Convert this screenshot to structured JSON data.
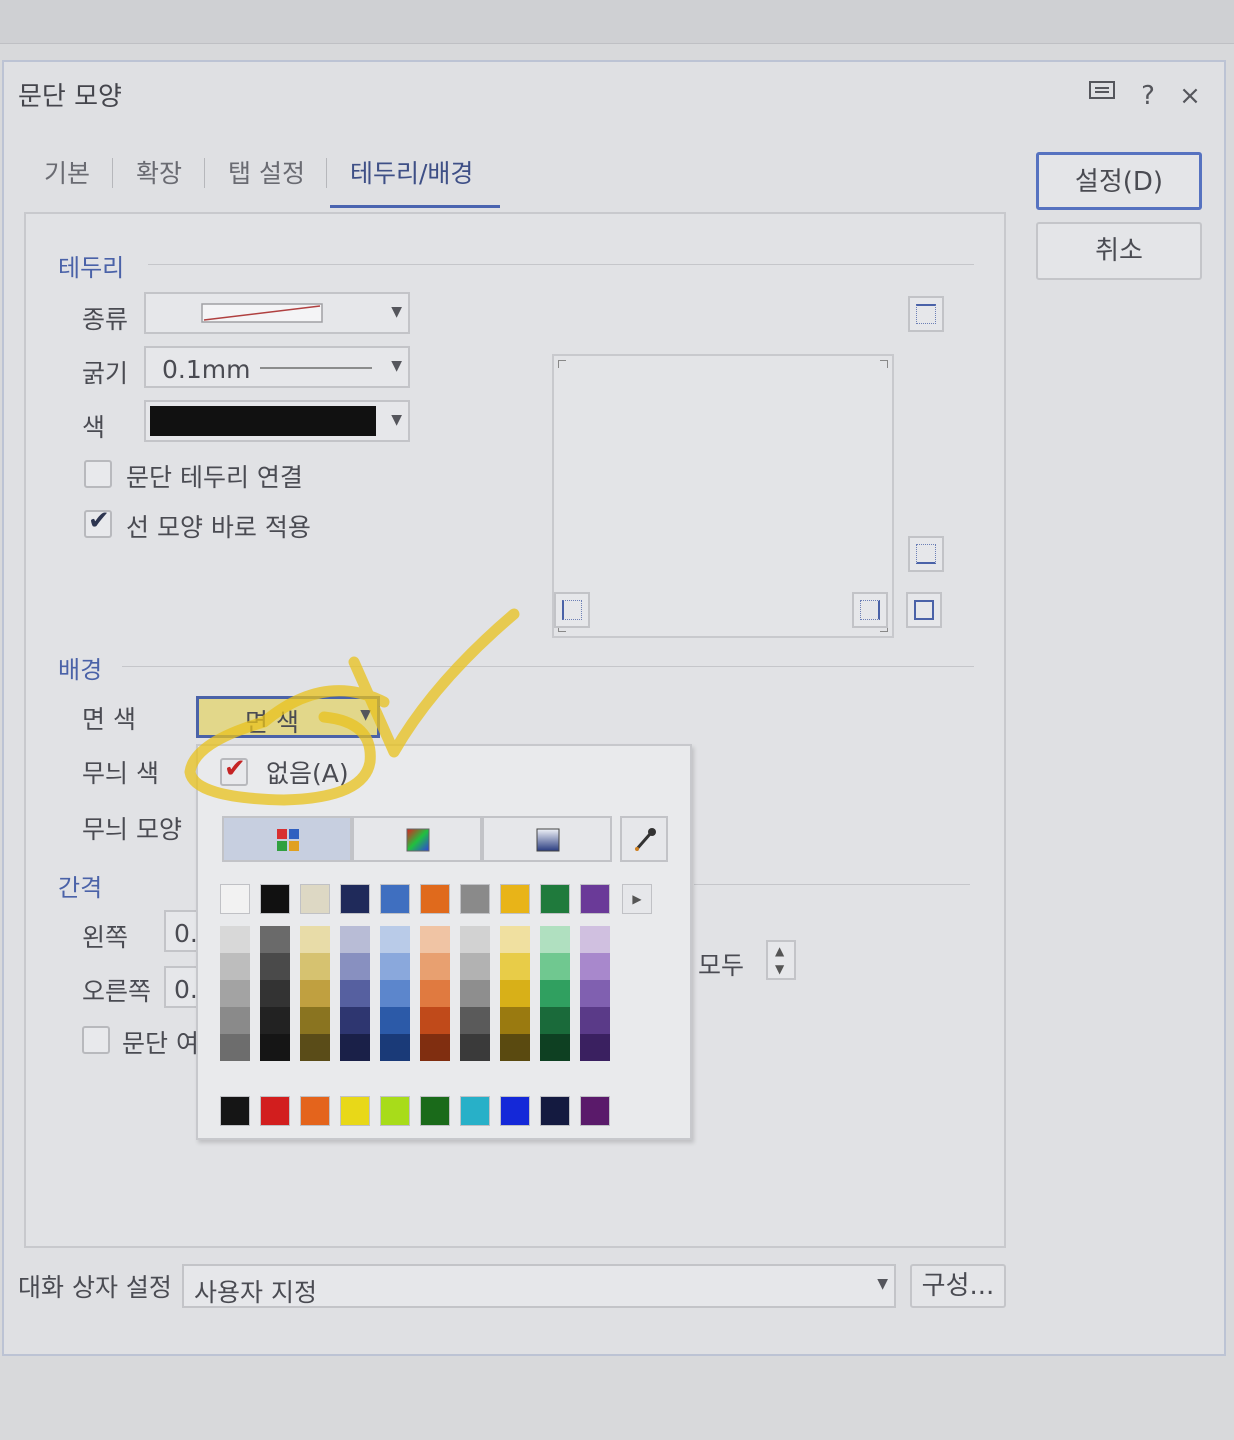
{
  "dialog": {
    "title": "문단 모양",
    "icons": [
      "comment-icon",
      "help-icon",
      "close-icon"
    ],
    "help_glyph": "?",
    "close_glyph": "×"
  },
  "tabs": [
    {
      "label": "기본"
    },
    {
      "label": "확장"
    },
    {
      "label": "탭 설정"
    },
    {
      "label": "테두리/배경",
      "active": true
    }
  ],
  "buttons": {
    "ok_label": "설정(D)",
    "cancel_label": "취소",
    "config_label": "구성..."
  },
  "border_section": {
    "title": "테두리",
    "type_label": "종류",
    "width_label": "굵기",
    "width_value": "0.1mm",
    "color_label": "색",
    "color_value": "#111111",
    "connect_label": "문단 테두리 연결",
    "connect_checked": false,
    "apply_label": "선 모양 바로 적용",
    "apply_checked": true
  },
  "background_section": {
    "title": "배경",
    "face_color_label": "면 색",
    "face_color_button": "면 색",
    "pattern_color_label": "무늬 색",
    "pattern_shape_label": "무늬 모양"
  },
  "spacing_section": {
    "title": "간격",
    "left_label": "왼쪽",
    "left_value": "0.",
    "right_label": "오른쪽",
    "right_value": "0.",
    "all_label": "모두",
    "paragraph_check_label": "문단 여"
  },
  "color_popup": {
    "none_label": "없음(A)",
    "none_checked": true,
    "top_row": [
      "#f2f2f2",
      "#111111",
      "#ddd8c4",
      "#1f2a5a",
      "#3f6fc0",
      "#e06a1c",
      "#8a8a8a",
      "#e8b418",
      "#1f7a3c",
      "#6a3a98"
    ],
    "shade_columns": [
      [
        "#d8d8d8",
        "#bdbdbd",
        "#a3a3a3",
        "#8a8a8a",
        "#6d6d6d"
      ],
      [
        "#6a6a6a",
        "#4a4a4a",
        "#333333",
        "#222222",
        "#151515"
      ],
      [
        "#e8dca8",
        "#d6c270",
        "#c0a040",
        "#8a7420",
        "#5a4c18"
      ],
      [
        "#b8bcd6",
        "#8890c0",
        "#5660a0",
        "#2e3670",
        "#1a2048"
      ],
      [
        "#b9cbe8",
        "#8aa8dc",
        "#5c86cc",
        "#2c5aa8",
        "#1a3a78"
      ],
      [
        "#f0c4a4",
        "#e8a070",
        "#e07a40",
        "#c04a1a",
        "#802e10"
      ],
      [
        "#d2d2d2",
        "#b2b2b2",
        "#8e8e8e",
        "#5a5a5a",
        "#3a3a3a"
      ],
      [
        "#f0e0a0",
        "#e8cc48",
        "#d8b018",
        "#9a7a10",
        "#5a4a10"
      ],
      [
        "#b0e0c0",
        "#70c890",
        "#30a060",
        "#1a6a3a",
        "#0e4022"
      ],
      [
        "#d0c0e0",
        "#a888cc",
        "#8060b0",
        "#5a3a88",
        "#3a2060"
      ]
    ],
    "standard_row": [
      "#151515",
      "#d21e1e",
      "#e4641c",
      "#e8d818",
      "#a8dc1a",
      "#1a6a1a",
      "#28b0c8",
      "#1428d8",
      "#141a40",
      "#5a1a6a"
    ],
    "more_arrow": "▶"
  },
  "footer": {
    "preset_label": "대화 상자 설정",
    "preset_value": "사용자 지정"
  },
  "annotation": {
    "highlight_color": "#e8c21c"
  }
}
